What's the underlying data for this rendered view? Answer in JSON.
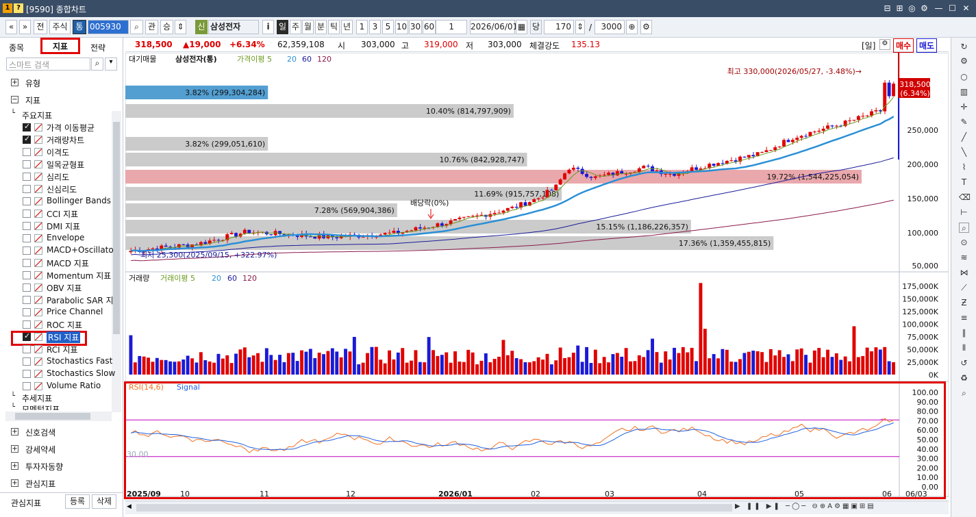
{
  "window": {
    "num1": "1",
    "num2": "?",
    "title": "[9590] 종합차트",
    "ctrls": [
      "⊟",
      "⊞",
      "◎",
      "⚙",
      "—",
      "☐",
      "✕"
    ]
  },
  "toolbar": {
    "nav": [
      "«",
      "»"
    ],
    "items": [
      "전",
      "주식",
      "통"
    ],
    "code": "005930",
    "buttons": [
      "관",
      "승"
    ],
    "badge": "신",
    "stock": "삼성전자",
    "info_btn": "i",
    "periods": [
      "일",
      "주",
      "월",
      "분",
      "틱",
      "년"
    ],
    "nums": [
      "1",
      "3",
      "5",
      "10",
      "30",
      "60"
    ],
    "interval": "1",
    "date": "2026/06/01",
    "unit_label": "당",
    "count": "170",
    "slash": "/",
    "total": "3000"
  },
  "left": {
    "tabs": [
      "종목",
      "지표",
      "전략"
    ],
    "search_placeholder": "스마트 검색",
    "groups": [
      {
        "label": "유형",
        "sign": "+"
      },
      {
        "label": "지표",
        "sign": "−"
      }
    ],
    "sub_header": "주요지표",
    "indicators": [
      {
        "label": "가격 이동평균",
        "checked": true
      },
      {
        "label": "거래량차트",
        "checked": true
      },
      {
        "label": "이격도",
        "checked": false
      },
      {
        "label": "일목균형표",
        "checked": false
      },
      {
        "label": "심리도",
        "checked": false
      },
      {
        "label": "신심리도",
        "checked": false
      },
      {
        "label": "Bollinger Bands",
        "checked": false
      },
      {
        "label": "CCI 지표",
        "checked": false
      },
      {
        "label": "DMI 지표",
        "checked": false
      },
      {
        "label": "Envelope",
        "checked": false
      },
      {
        "label": "MACD+Oscillato",
        "checked": false
      },
      {
        "label": "MACD 지표",
        "checked": false
      },
      {
        "label": "Momentum 지표",
        "checked": false
      },
      {
        "label": "OBV 지표",
        "checked": false
      },
      {
        "label": "Parabolic SAR 지",
        "checked": false
      },
      {
        "label": "Price Channel",
        "checked": false
      },
      {
        "label": "ROC 지표",
        "checked": false
      },
      {
        "label": "RSI 지표",
        "checked": true
      },
      {
        "label": "RCI 지표",
        "checked": false
      },
      {
        "label": "Stochastics Fast",
        "checked": false
      },
      {
        "label": "Stochastics Slow",
        "checked": false
      },
      {
        "label": "Volume Ratio",
        "checked": false
      }
    ],
    "after": [
      "추세지표",
      "모멘텀지표"
    ],
    "bottom_groups": [
      "신호검색",
      "강세약세",
      "투자자동향",
      "관심지표"
    ],
    "fav_label": "관심지표",
    "register": "등록",
    "delete": "삭제"
  },
  "quote": {
    "price": "318,500",
    "change": "▲19,000",
    "rate": "+6.34%",
    "volume": "62,359,108",
    "open_l": "시",
    "open": "303,000",
    "high_l": "고",
    "high": "319,000",
    "low_l": "저",
    "low": "303,000",
    "str_l": "체결강도",
    "str": "135.13",
    "period": "[일]",
    "buy": "매수",
    "sell": "매도"
  },
  "price_pane": {
    "legend_prefix": "대기매물",
    "legend_stock": "삼성전자(통)",
    "legend_ma": "가격이평 5",
    "legend_20": "20",
    "legend_60": "60",
    "legend_120": "120",
    "high_note": "최고 330,000(2026/05/27, -3.48%)→",
    "low_note": "최저 25,300(2025/09/15, +322.97%)",
    "div_note": "배당락(0%)",
    "cur_price": "318,500",
    "cur_rate": "(6.34%)",
    "axis": [
      "250,000",
      "200,000",
      "150,000",
      "100,000",
      "50,000"
    ]
  },
  "vol_pane": {
    "legend": "거래량",
    "legend_ma": "거래이평 5",
    "legend_20": "20",
    "legend_60": "60",
    "legend_120": "120",
    "axis": [
      "175,000K",
      "150,000K",
      "125,000K",
      "100,000K",
      "75,000K",
      "50,000K",
      "25,000K",
      "0K"
    ]
  },
  "rsi_pane": {
    "legend": "RSI(14,6)",
    "legend_sig": "Signal",
    "level": "30.00",
    "axis": [
      "100.00",
      "90.00",
      "80.00",
      "70.00",
      "60.00",
      "50.00",
      "40.00",
      "30.00",
      "20.00",
      "10.00",
      "0.00"
    ]
  },
  "xaxis": [
    "2025/09",
    "10",
    "11",
    "12",
    "2026/01",
    "02",
    "03",
    "04",
    "05",
    "06",
    "06/03"
  ],
  "volume_profile": [
    {
      "label": "3.82% (299,304,284)",
      "pct": 3.82
    },
    {
      "label": "10.40% (814,797,909)",
      "pct": 10.4
    },
    {
      "label": "3.82% (299,051,610)",
      "pct": 3.82
    },
    {
      "label": "10.76% (842,928,747)",
      "pct": 10.76
    },
    {
      "label": "19.72% (1,544,225,054)",
      "pct": 19.72
    },
    {
      "label": "11.69% (915,757,108)",
      "pct": 11.69
    },
    {
      "label": "7.28% (569,904,386)",
      "pct": 7.28
    },
    {
      "label": "15.15% (1,186,226,357)",
      "pct": 15.15
    },
    {
      "label": "17.36% (1,359,455,815)",
      "pct": 17.36
    }
  ],
  "colors": {
    "up": "#e00000",
    "down": "#1a1ad6",
    "ma5": "#6b9a1e",
    "ma20": "#2a8fd6",
    "ma60": "#1a1a9a",
    "ma120": "#8a1a4a",
    "rsi": "#f07020",
    "signal": "#2060e0",
    "rsi_fill": "#f080c0",
    "level": "#c000c0",
    "highlight": "#e00000"
  }
}
